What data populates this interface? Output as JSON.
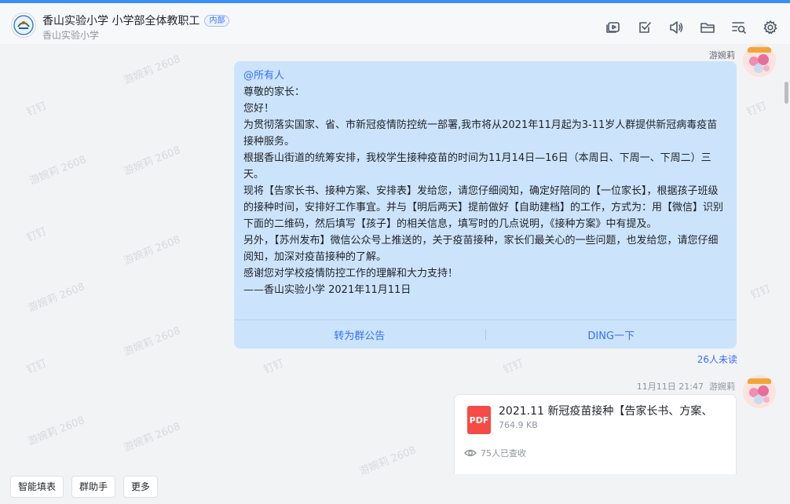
{
  "header": {
    "group_title": "香山实验小学 小学部全体教职工",
    "tag": "内部",
    "subtitle": "香山实验小学",
    "toolbar": [
      "video-icon",
      "task-check-icon",
      "speaker-icon",
      "folder-icon",
      "search-list-icon",
      "gear-icon"
    ]
  },
  "watermark": "游婉莉 2608",
  "watermark_short": "钉钉",
  "message1": {
    "sender": "游婉莉",
    "mention": "@所有人",
    "lines": [
      "尊敬的家长：",
      "您好！",
      "为贯彻落实国家、省、市新冠疫情防控统一部署,我市将从2021年11月起为3-11岁人群提供新冠病毒疫苗接种服务。",
      "根据香山街道的统筹安排，我校学生接种疫苗的时间为11月14日—16日（本周日、下周一、下周二）三天。",
      "现将【告家长书、接种方案、安排表】发给您，请您仔细阅知，确定好陪同的【一位家长】，根据孩子班级的接种时间，安排好工作事宜。并与【明后两天】提前做好【自助建档】的工作，方式为：用【微信】识别下面的二维码，然后填写【孩子】的相关信息，填写时的几点说明，《接种方案》中有提及。",
      "另外，【苏州发布】微信公众号上推送的，关于疫苗接种，家长们最关心的一些问题，也发给您，请您仔细阅知，加深对疫苗接种的了解。",
      "感谢您对学校疫情防控工作的理解和大力支持！",
      "——香山实验小学 2021年11月11日"
    ],
    "action_left": "转为群公告",
    "action_right": "DING一下",
    "unread": "26人未读"
  },
  "message2": {
    "time": "11月11日 21:47",
    "sender": "游婉莉",
    "file_name": "2021.11 新冠疫苗接种【告家长书、方案、",
    "file_size": "764.9 KB",
    "file_type": "PDF",
    "views": "75人已查收"
  },
  "bottom_bar": {
    "buttons": [
      "智能填表",
      "群助手",
      "更多"
    ]
  }
}
